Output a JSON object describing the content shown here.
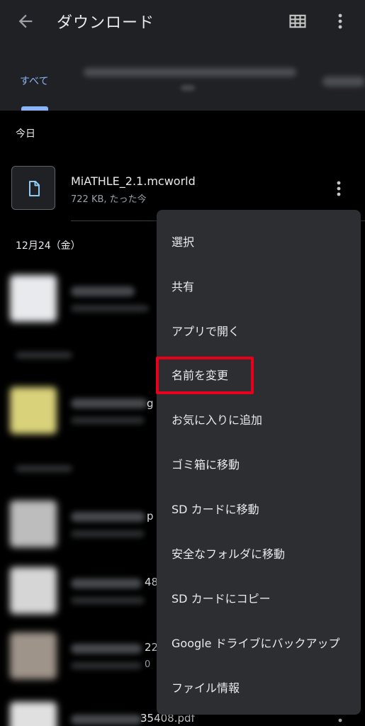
{
  "appbar": {
    "title": "ダウンロード",
    "back_icon": "arrow-back-icon",
    "grid_icon": "grid-view-icon",
    "more_icon": "more-vert-icon"
  },
  "tabs": {
    "active_label": "すべて"
  },
  "list": {
    "today_label": "今日",
    "date_label": "12月24（金）",
    "file": {
      "name": "MiATHLE_2.1.mcworld",
      "meta": "722 KB, たった今",
      "icon": "document-icon"
    },
    "peek": {
      "row1": "g",
      "row2": "p",
      "row3": "48",
      "row4": "22",
      "row4b": "0",
      "row5": "35408.pdf"
    }
  },
  "context_menu": {
    "items": [
      "選択",
      "共有",
      "アプリで開く",
      "名前を変更",
      "お気に入りに追加",
      "ゴミ箱に移動",
      "SD カードに移動",
      "安全なフォルダに移動",
      "SD カードにコピー",
      "Google ドライブにバックアップ",
      "ファイル情報"
    ],
    "highlighted_index": 3
  },
  "colors": {
    "background": "#000000",
    "surface": "#202124",
    "menu": "#2d2e31",
    "accent": "#8ab4f8",
    "highlight": "#e8001a"
  }
}
